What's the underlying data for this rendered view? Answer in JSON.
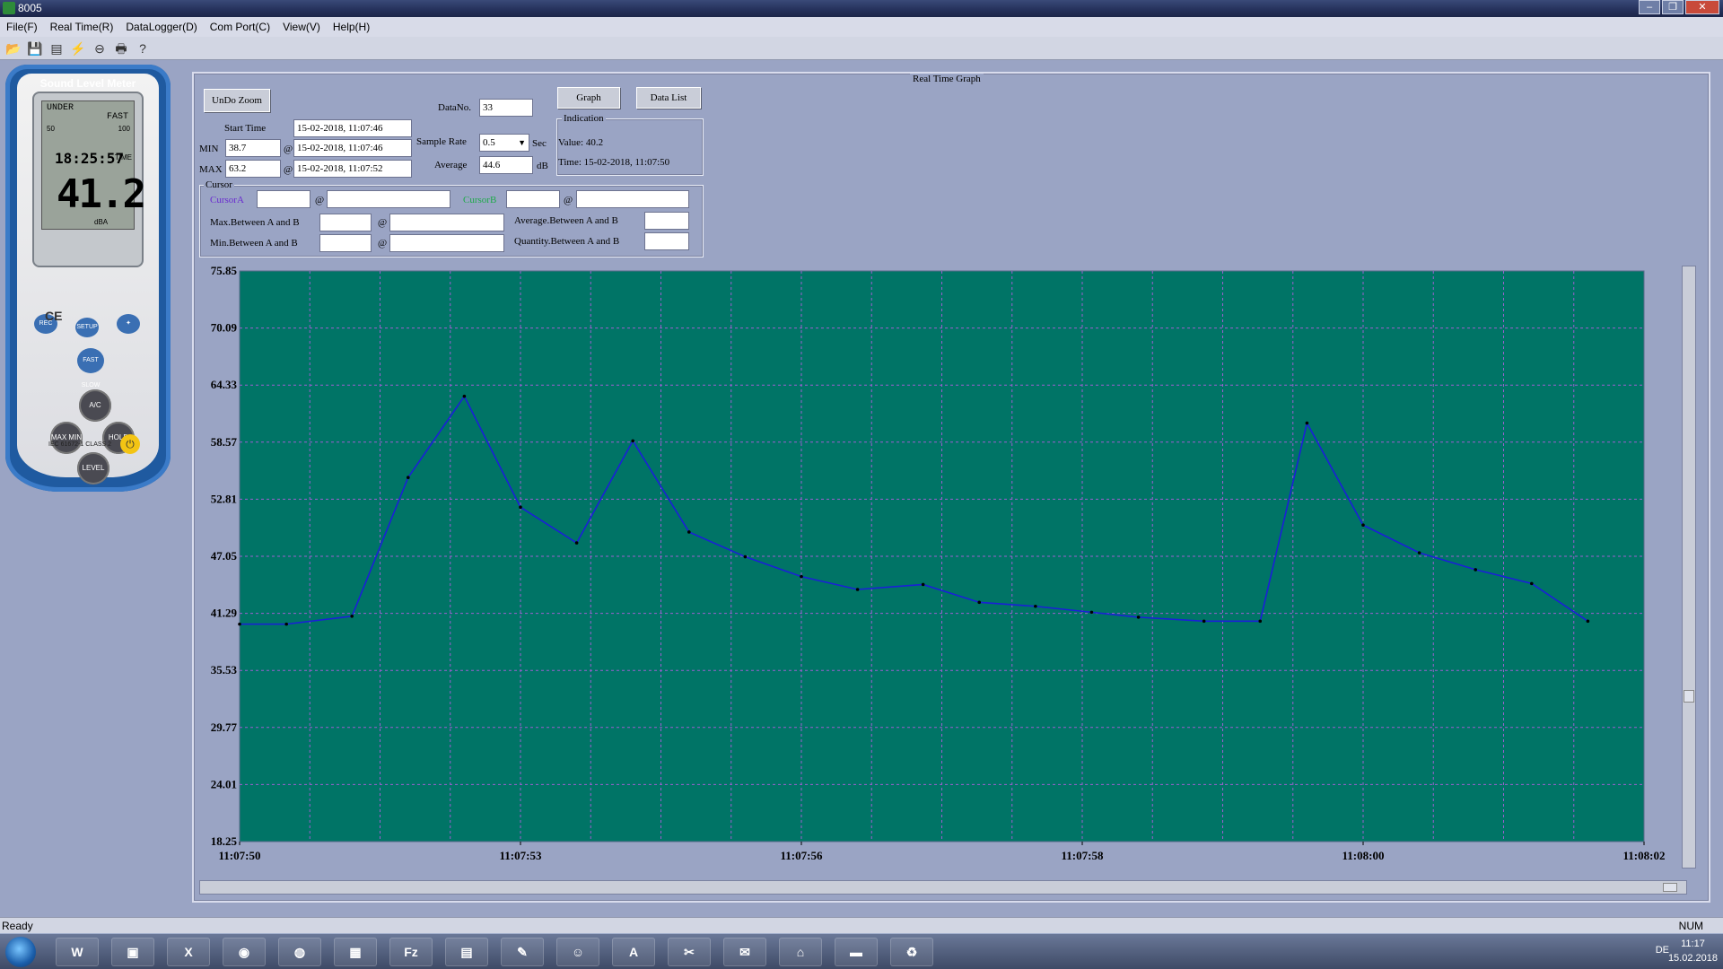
{
  "window": {
    "title": "8005",
    "controls": [
      "–",
      "❐",
      "✕"
    ]
  },
  "menu": [
    "File(F)",
    "Real Time(R)",
    "DataLogger(D)",
    "Com Port(C)",
    "View(V)",
    "Help(H)"
  ],
  "toolbar_icons": [
    "open-icon",
    "save-icon",
    "window-icon",
    "connect-icon",
    "stop-icon",
    "print-icon",
    "help-icon"
  ],
  "meter": {
    "title": "Sound Level Meter",
    "under": "UNDER",
    "fast": "FAST",
    "scale_low": "50",
    "scale_high": "100",
    "time": "18:25:57",
    "time_label": "TIME",
    "reading": "41.2",
    "unit": "dBA",
    "buttons": [
      "REC",
      "SETUP",
      "✦",
      "FAST SLOW",
      "A/C",
      "MAX MIN",
      "HOLD",
      "LEVEL"
    ],
    "ce": "CE",
    "iec": "IEC 61672-1 CLASS 2",
    "power": "⏻"
  },
  "panel": {
    "title": "Real Time Graph",
    "undo_zoom": "UnDo Zoom",
    "graph_btn": "Graph",
    "datalist_btn": "Data List",
    "datano_label": "DataNo.",
    "datano_value": "33",
    "start_time_label": "Start Time",
    "start_time_value": "15-02-2018, 11:07:46",
    "min_label": "MIN",
    "min_value": "38.7",
    "min_time": "15-02-2018, 11:07:46",
    "max_label": "MAX",
    "max_value": "63.2",
    "max_time": "15-02-2018, 11:07:52",
    "at": "@",
    "sample_rate_label": "Sample Rate",
    "sample_rate_value": "0.5",
    "sec": "Sec",
    "average_label": "Average",
    "average_value": "44.6",
    "db": "dB",
    "indication_title": "Indication",
    "ind_value": "Value: 40.2",
    "ind_time": "Time:  15-02-2018, 11:07:50",
    "cursor_title": "Cursor",
    "cursor_a": "CursorA",
    "cursor_b": "CursorB",
    "max_ab": "Max.Between A and B",
    "min_ab": "Min.Between A and B",
    "avg_ab": "Average.Between A and B",
    "qty_ab": "Quantity.Between A and B"
  },
  "chart_data": {
    "type": "line",
    "title": "",
    "xlabel": "",
    "ylabel": "",
    "ylim": [
      18.25,
      75.85
    ],
    "y_ticks": [
      "75.85",
      "70.09",
      "64.33",
      "58.57",
      "52.81",
      "47.05",
      "41.29",
      "35.53",
      "29.77",
      "24.01",
      "18.25"
    ],
    "x_ticks": [
      "11:07:50",
      "11:07:53",
      "11:07:56",
      "11:07:58",
      "11:08:00",
      "11:08:02"
    ],
    "x": [
      0,
      0.5,
      1.2,
      1.8,
      2.4,
      3.0,
      3.6,
      4.2,
      4.8,
      5.4,
      6.0,
      6.6,
      7.3,
      7.9,
      8.5,
      9.1,
      9.6,
      10.3,
      10.9,
      11.4,
      12.0,
      12.6,
      13.2,
      13.8,
      14.4
    ],
    "series": [
      {
        "values": [
          40.2,
          40.2,
          41.0,
          55.0,
          63.2,
          52.0,
          48.4,
          58.7,
          49.5,
          47.0,
          45.0,
          43.7,
          44.2,
          42.4,
          42.0,
          41.4,
          40.9,
          40.5,
          40.5,
          60.5,
          50.2,
          47.4,
          45.7,
          44.3,
          40.5
        ]
      }
    ],
    "series_color": "#1a1fd8",
    "plot_bg": "#007466",
    "grid": true
  },
  "status": {
    "left": "Ready",
    "right": "NUM"
  },
  "taskbar": {
    "apps": [
      "W",
      "▣",
      "X",
      "◉",
      "◍",
      "▦",
      "Fz",
      "▤",
      "✎",
      "☺",
      "A",
      "✂",
      "✉",
      "⌂",
      "▬",
      "♻"
    ],
    "lang": "DE",
    "time": "11:17",
    "date": "15.02.2018"
  }
}
